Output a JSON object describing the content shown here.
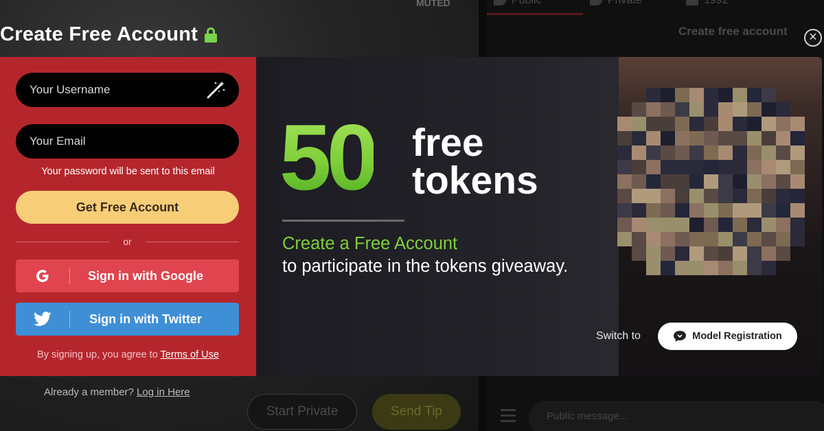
{
  "background": {
    "muted_label": "MUTED",
    "tabs": [
      "Public",
      "Private",
      "1992"
    ],
    "create_link": "Create free account",
    "already_member": "Already a member?",
    "login_link": "Log in Here",
    "start_private": "Start Private",
    "send_tip": "Send Tip",
    "chat_placeholder": "Public message..."
  },
  "modal": {
    "title": "Create Free Account",
    "close_label": "×",
    "form": {
      "username_placeholder": "Your Username",
      "email_placeholder": "Your Email",
      "email_hint": "Your password will be sent to this email",
      "submit_label": "Get Free Account",
      "or_label": "or",
      "google_label": "Sign in with Google",
      "twitter_label": "Sign in with Twitter",
      "terms_prefix": "By signing up, you agree to",
      "terms_link": "Terms of Use"
    },
    "promo": {
      "amount": "50",
      "word1": "free",
      "word2": "tokens",
      "cta": "Create a Free Account",
      "subtext": "to participate in the tokens giveaway.",
      "switch_label": "Switch to",
      "model_button": "Model Registration"
    }
  },
  "colors": {
    "accent_green": "#7fcf3a",
    "panel_red": "#b5262c",
    "primary_yellow": "#f7cd78",
    "google_red": "#e0444e",
    "twitter_blue": "#3f8fd6"
  }
}
